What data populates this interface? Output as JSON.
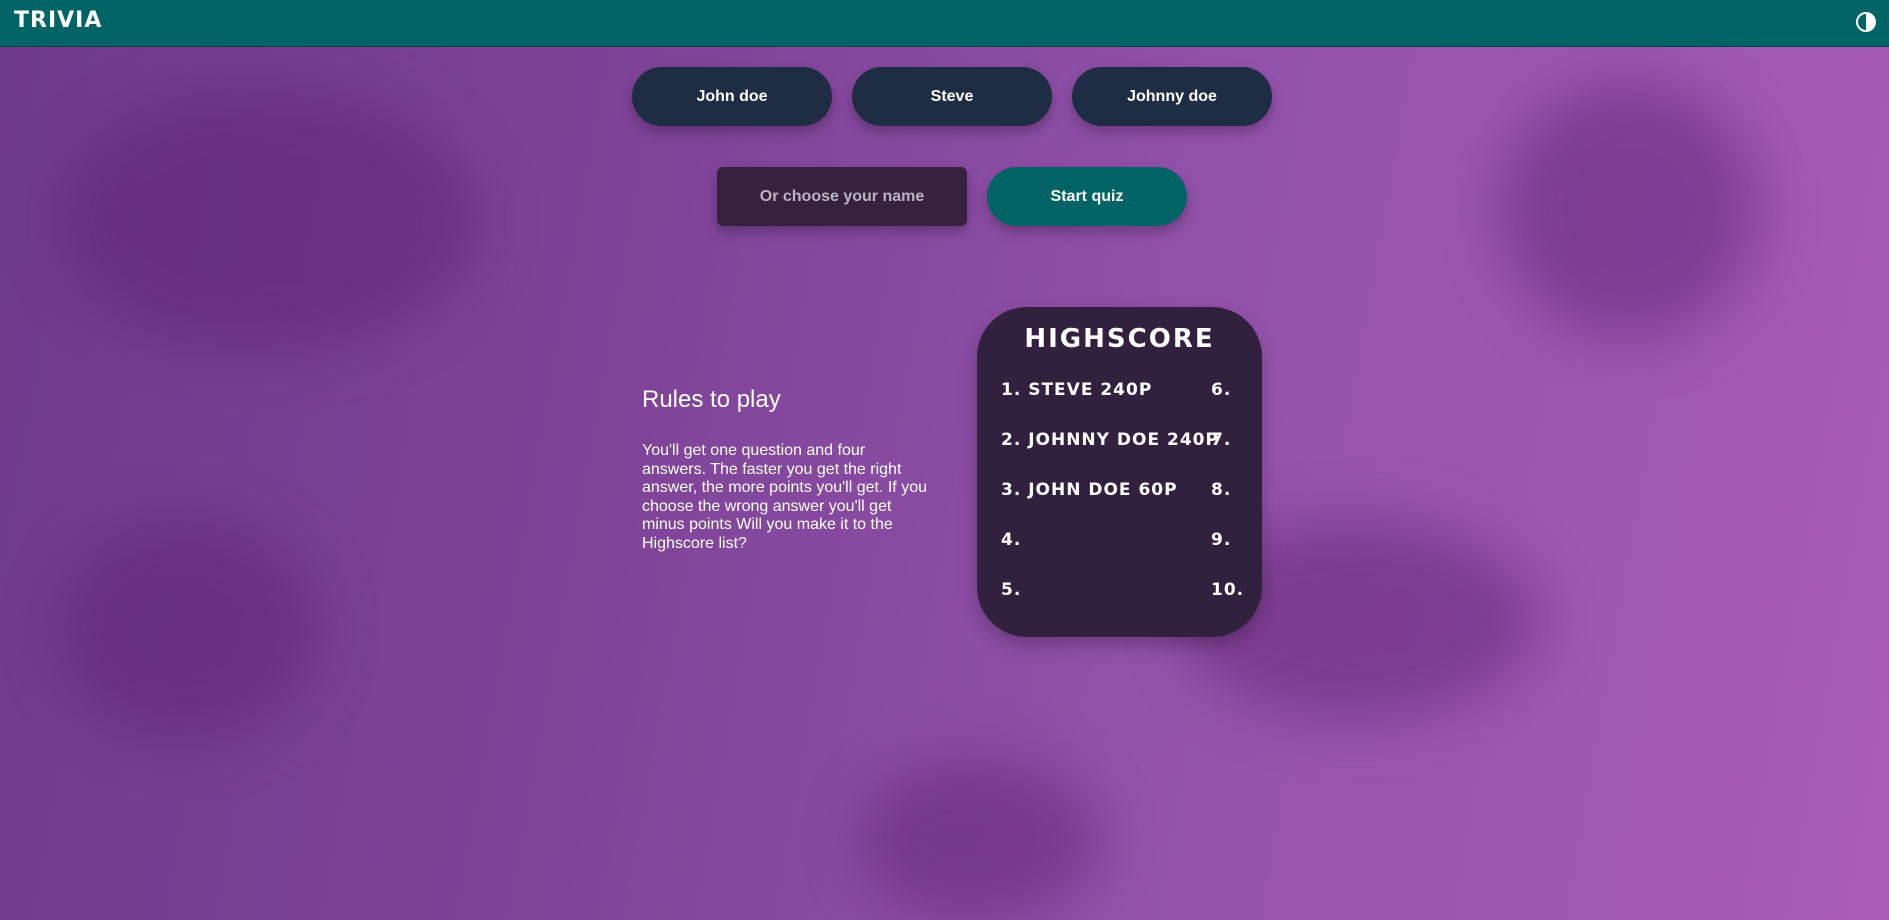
{
  "header": {
    "logo": "TRIVIA",
    "theme_toggle_icon": "contrast-icon"
  },
  "players": [
    {
      "label": "John doe"
    },
    {
      "label": "Steve"
    },
    {
      "label": "Johnny doe"
    }
  ],
  "name_input": {
    "placeholder": "Or choose your name",
    "value": ""
  },
  "start_button": {
    "label": "Start quiz"
  },
  "rules": {
    "title": "Rules to play",
    "text": "You'll get one question and four answers. The faster you get the right answer, the more points you'll get. If you choose the wrong answer you'll get minus points Will you make it to the Highscore list?"
  },
  "highscore": {
    "title": "HIGHSCORE",
    "entries": [
      "1. STEVE 240P",
      "2. JOHNNY DOE 240P",
      "3. JOHN DOE 60P",
      "4.",
      "5.",
      "6.",
      "7.",
      "8.",
      "9.",
      "10."
    ]
  },
  "colors": {
    "header": "#006466",
    "name_button": "#1f2d44",
    "start_button": "#006466",
    "card": "#32203f",
    "input": "#36213f"
  }
}
